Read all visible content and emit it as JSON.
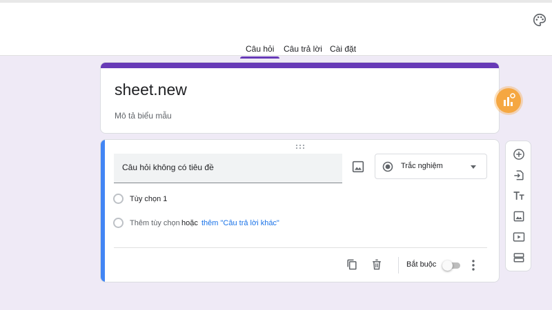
{
  "tabs": [
    {
      "label": "Câu hỏi",
      "active": true
    },
    {
      "label": "Câu trả lời",
      "active": false
    },
    {
      "label": "Cài đặt",
      "active": false
    }
  ],
  "form": {
    "title": "sheet.new",
    "description_placeholder": "Mô tả biểu mẫu",
    "accent_color": "#673ab7"
  },
  "question": {
    "title_placeholder": "Câu hỏi không có tiêu đề",
    "type": "Trắc nghiệm",
    "options": [
      "Tùy chọn 1"
    ],
    "add_option": "Thêm tùy chọn",
    "or": "hoặc",
    "add_other": "thêm \"Câu trả lời khác\"",
    "required_label": "Bắt buộc",
    "required": false
  },
  "icons": {
    "palette": "palette-icon",
    "image": "image-icon",
    "radio": "radio-button-icon",
    "copy": "duplicate-icon",
    "delete": "trash-icon",
    "more": "more-vert-icon",
    "toolbar": [
      "add-question-icon",
      "import-questions-icon",
      "add-title-icon",
      "add-image-icon",
      "add-video-icon",
      "add-section-icon"
    ]
  }
}
